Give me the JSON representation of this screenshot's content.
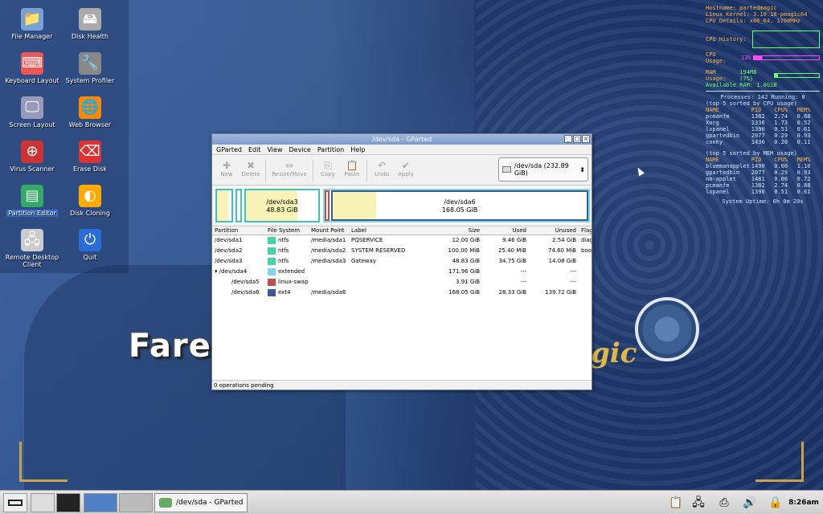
{
  "desktop": {
    "icons": [
      {
        "label": "File Manager",
        "glyph": "📁"
      },
      {
        "label": "Disk Health",
        "glyph": "🖴"
      },
      {
        "label": "Keyboard Layout",
        "glyph": "⌨"
      },
      {
        "label": "System Profiler",
        "glyph": "🔧"
      },
      {
        "label": "Screen Layout",
        "glyph": "🖵"
      },
      {
        "label": "Web Browser",
        "glyph": "🌐"
      },
      {
        "label": "Virus Scanner",
        "glyph": "⊕"
      },
      {
        "label": "Erase Disk",
        "glyph": "⌫"
      },
      {
        "label": "Partition Editor",
        "glyph": "▤"
      },
      {
        "label": "Disk Cloning",
        "glyph": "◐"
      },
      {
        "label": "Remote Desktop Client",
        "glyph": "🖧"
      },
      {
        "label": "Quit",
        "glyph": "⏻"
      }
    ],
    "watermark": "FaresCD.Com"
  },
  "conky": {
    "hostname": "Hostname: partedmagic",
    "kernel": "Linux Kernel: 3.10.18-pmagic64",
    "cpu_details": "CPU Details: x86_64, 1700MHz",
    "cpu_history_label": "CPU History:",
    "cpu_usage_label": "CPU Usage:",
    "cpu_usage_value": "13%",
    "ram_usage_label": "RAM Usage:",
    "ram_usage_value": "194MB (7%)",
    "available_ram": "Available RAM: 1.8GiB",
    "processes": "Processes: 142  Running: 0",
    "top_cpu_title": "(top 5 sorted by CPU usage)",
    "top_mem_title": "(top 5 sorted by MEM usage)",
    "columns": [
      "NAME",
      "PID",
      "CPU%",
      "MEM%"
    ],
    "top_cpu": [
      [
        "pcmanfm",
        "1382",
        "2.74",
        "0.88"
      ],
      [
        "Xorg",
        "1336",
        "1.73",
        "0.52"
      ],
      [
        "lxpanel",
        "1390",
        "0.51",
        "0.61"
      ],
      [
        "gpartedbin",
        "2077",
        "0.29",
        "0.93"
      ],
      [
        "conky",
        "1436",
        "0.20",
        "0.11"
      ]
    ],
    "top_mem": [
      [
        "bluemanapplet",
        "1490",
        "0.00",
        "1.10"
      ],
      [
        "gpartedbin",
        "2077",
        "0.29",
        "0.93"
      ],
      [
        "nm-applet",
        "1481",
        "0.00",
        "0.72"
      ],
      [
        "pcmanfm",
        "1382",
        "2.74",
        "0.88"
      ],
      [
        "lxpanel",
        "1390",
        "0.51",
        "0.61"
      ]
    ],
    "uptime": "System Uptime: 0h 0m 20s"
  },
  "window": {
    "title": "/dev/sda - GParted",
    "menu": [
      "GParted",
      "Edit",
      "View",
      "Device",
      "Partition",
      "Help"
    ],
    "toolbar": [
      {
        "label": "New",
        "glyph": "✚"
      },
      {
        "label": "Delete",
        "glyph": "✖"
      },
      {
        "label": "Resize/Move",
        "glyph": "⇔"
      },
      {
        "label": "Copy",
        "glyph": "⎘"
      },
      {
        "label": "Paste",
        "glyph": "📋"
      },
      {
        "label": "Undo",
        "glyph": "↶"
      },
      {
        "label": "Apply",
        "glyph": "✔"
      }
    ],
    "device_selector": "/dev/sda   (232.89 GiB)",
    "diskmap": [
      {
        "name": "/dev/sda3",
        "size": "48.83 GiB"
      },
      {
        "name": "/dev/sda6",
        "size": "168.05 GiB"
      }
    ],
    "columns": [
      "Partition",
      "File System",
      "Mount Point",
      "Label",
      "Size",
      "Used",
      "Unused",
      "Flags"
    ],
    "rows": [
      {
        "partition": "/dev/sda1",
        "fs": "ntfs",
        "color": "#42d6a4",
        "mount": "/media/sda1",
        "label": "PQSERVICE",
        "size": "12.00 GiB",
        "used": "9.46 GiB",
        "unused": "2.54 GiB",
        "flags": "diag"
      },
      {
        "partition": "/dev/sda2",
        "fs": "ntfs",
        "color": "#42d6a4",
        "mount": "/media/sda2",
        "label": "SYSTEM RESERVED",
        "size": "100.00 MiB",
        "used": "25.40 MiB",
        "unused": "74.60 MiB",
        "flags": "boot"
      },
      {
        "partition": "/dev/sda3",
        "fs": "ntfs",
        "color": "#42d6a4",
        "mount": "/media/sda3",
        "label": "Gateway",
        "size": "48.83 GiB",
        "used": "34.75 GiB",
        "unused": "14.08 GiB",
        "flags": ""
      },
      {
        "partition": "/dev/sda4",
        "fs": "extended",
        "color": "#7fd7e8",
        "mount": "",
        "label": "",
        "size": "171.96 GiB",
        "used": "---",
        "unused": "---",
        "flags": ""
      },
      {
        "partition": "/dev/sda5",
        "fs": "linux-swap",
        "color": "#c0504d",
        "mount": "",
        "label": "",
        "size": "3.91 GiB",
        "used": "---",
        "unused": "---",
        "flags": ""
      },
      {
        "partition": "/dev/sda6",
        "fs": "ext4",
        "color": "#3a5a9a",
        "mount": "/media/sda6",
        "label": "",
        "size": "168.05 GiB",
        "used": "28.33 GiB",
        "unused": "139.72 GiB",
        "flags": ""
      }
    ],
    "status": "0 operations pending"
  },
  "taskbar": {
    "task_label": "/dev/sda - GParted",
    "clock": "8:26am"
  }
}
